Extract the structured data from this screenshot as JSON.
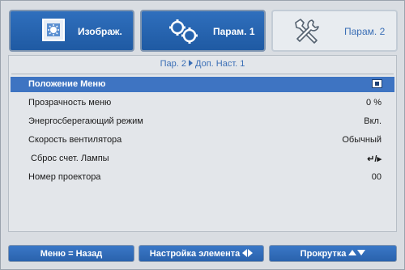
{
  "colors": {
    "accent": "#3e74c2",
    "tab_dark": "#1f5aa3",
    "breadcrumb": "#3b6fb6"
  },
  "tabs": [
    {
      "label": "Изображ.",
      "icon": "image-icon",
      "active": false
    },
    {
      "label": "Парам. 1",
      "icon": "gears-icon",
      "active": false
    },
    {
      "label": "Парам. 2",
      "icon": "tools-icon",
      "active": true
    }
  ],
  "breadcrumb": {
    "part1": "Пар. 2",
    "part2": "Доп. Наст. 1"
  },
  "menu": [
    {
      "label": "Положение Меню",
      "value": "",
      "value_icon": "menu-position-icon",
      "selected": true
    },
    {
      "label": "Прозрачность меню",
      "value": "0 %",
      "selected": false
    },
    {
      "label": "Энергосберегающий режим",
      "value": "Вкл.",
      "selected": false
    },
    {
      "label": "Скорость вентилятора",
      "value": "Обычный",
      "selected": false
    },
    {
      "label": "Сброс счет. Лампы",
      "value": "↵/▸",
      "selected": false
    },
    {
      "label": "Номер проектора",
      "value": "00",
      "selected": false
    }
  ],
  "bottom": {
    "back": "Меню = Назад",
    "adjust": "Настройка элемента",
    "scroll": "Прокрутка"
  }
}
